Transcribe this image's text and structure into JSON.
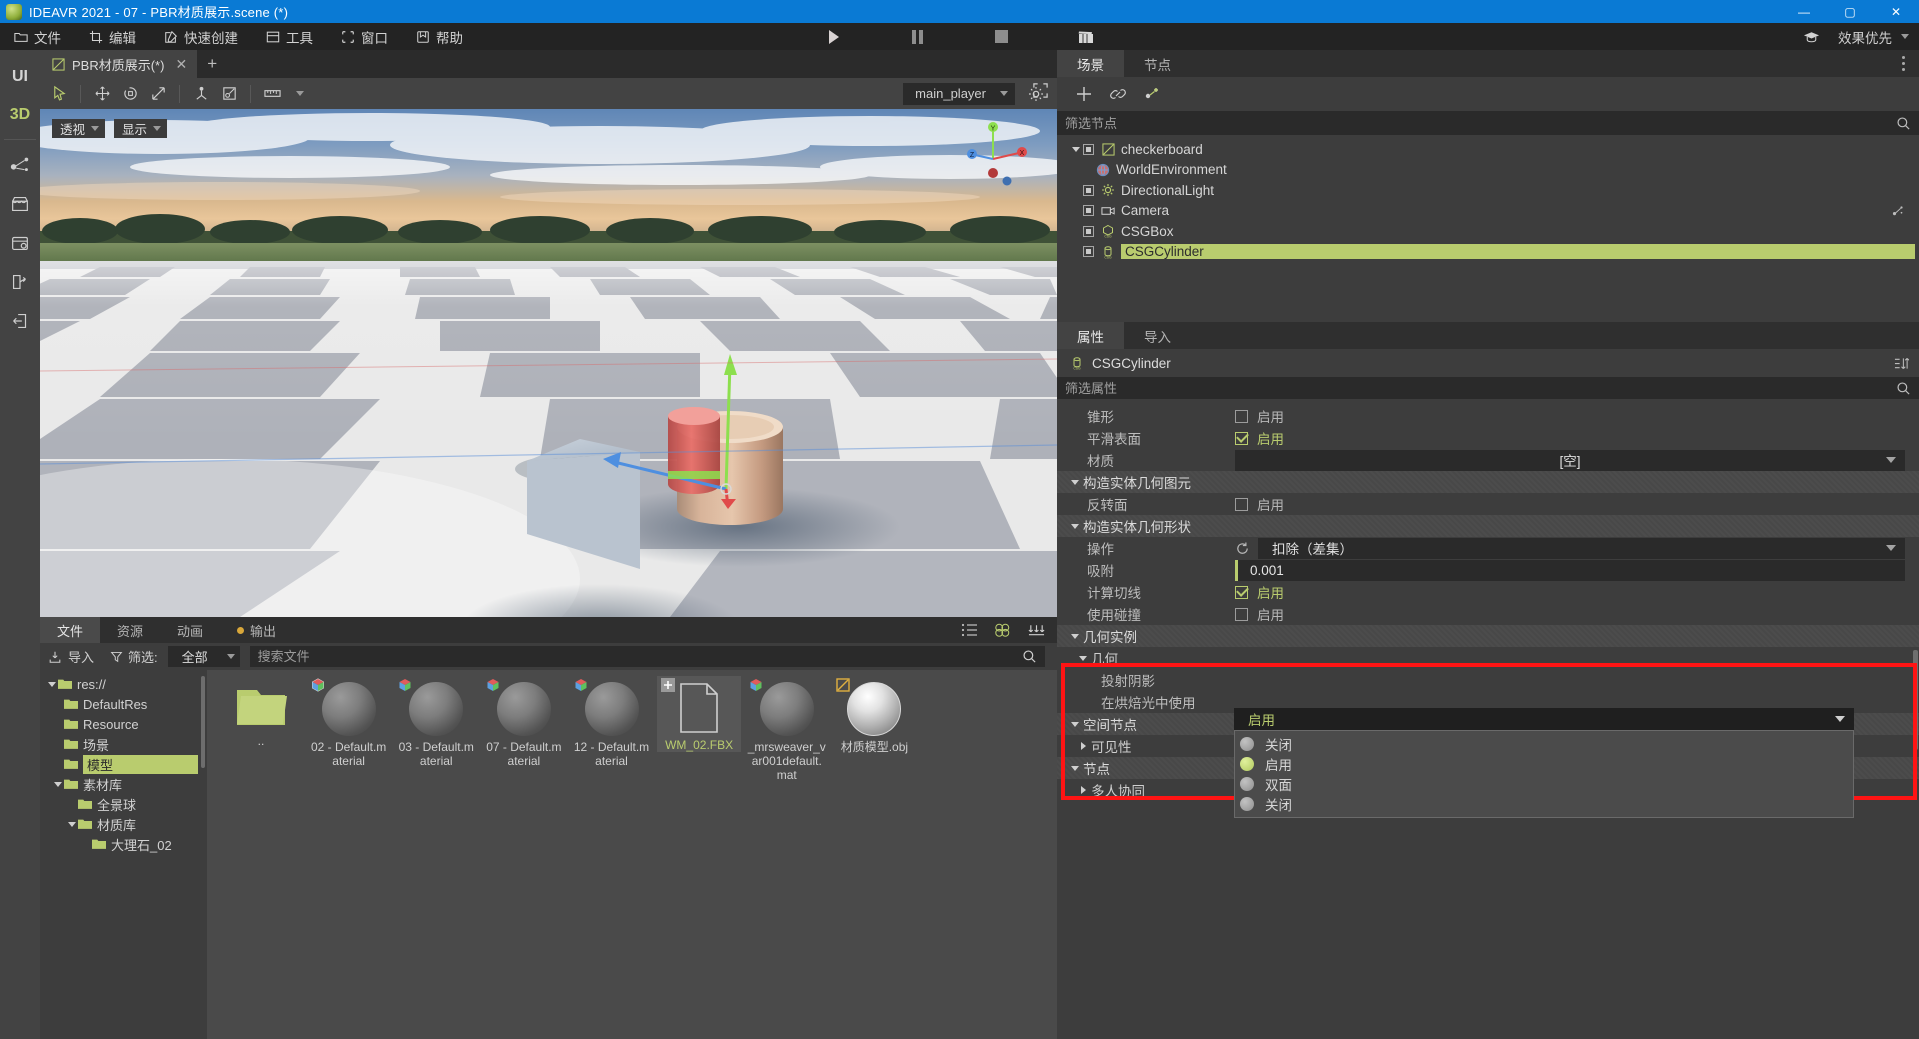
{
  "titlebar": {
    "title": "IDEAVR 2021 - 07 - PBR材质展示.scene (*)",
    "minimize": "—",
    "maximize": "▢",
    "close": "✕"
  },
  "menubar": {
    "items": [
      {
        "label": "文件",
        "icon": "folder-icon"
      },
      {
        "label": "编辑",
        "icon": "edit-crop-icon"
      },
      {
        "label": "快速创建",
        "icon": "pencil-square-icon"
      },
      {
        "label": "工具",
        "icon": "window-icon"
      },
      {
        "label": "窗口",
        "icon": "frame-icon"
      },
      {
        "label": "帮助",
        "icon": "help-book-icon"
      }
    ],
    "playback": [
      {
        "name": "play-button",
        "icon": "play-icon"
      },
      {
        "name": "pause-button",
        "icon": "pause-icon"
      },
      {
        "name": "stop-button",
        "icon": "stop-icon"
      },
      {
        "name": "movie-button",
        "icon": "clapperboard-icon"
      }
    ],
    "right": {
      "graduation_icon": "graduation-cap-icon",
      "quality_label": "效果优先"
    }
  },
  "rail": {
    "ui_label": "UI",
    "d3_label": "3D",
    "buttons": [
      {
        "name": "node-graph-icon"
      },
      {
        "name": "store-icon"
      },
      {
        "name": "settings-window-icon"
      },
      {
        "name": "export-icon"
      },
      {
        "name": "import-door-icon"
      }
    ]
  },
  "editor": {
    "tab": {
      "label": "PBR材质展示(*)",
      "close": "✕",
      "add": "+"
    },
    "toolbar": {
      "tools": [
        {
          "name": "select-tool",
          "icon": "cursor-icon",
          "active": true
        },
        {
          "name": "move-tool",
          "icon": "move-arrows-icon"
        },
        {
          "name": "rotate-tool",
          "icon": "rotate-icon"
        },
        {
          "name": "scale-tool",
          "icon": "scale-icon"
        },
        {
          "name": "snap-tool",
          "icon": "anchor-icon"
        },
        {
          "name": "local-space-tool",
          "icon": "local-space-icon"
        },
        {
          "name": "ruler-tool",
          "icon": "ruler-icon"
        }
      ],
      "player_select": "main_player",
      "settings_icon": "gear-icon"
    },
    "viewport": {
      "perspective_label": "透视",
      "display_label": "显示",
      "expand_icon": "expand-icon",
      "gizmo_axes": [
        "X",
        "Y",
        "Z"
      ]
    }
  },
  "filepanel": {
    "tabs": [
      {
        "label": "文件",
        "active": true
      },
      {
        "label": "资源",
        "active": false
      },
      {
        "label": "动画",
        "active": false
      },
      {
        "label": "输出",
        "active": false,
        "dot": true
      }
    ],
    "tools_right": [
      {
        "name": "list-view-icon"
      },
      {
        "name": "grid-view-icon"
      },
      {
        "name": "sort-icon"
      }
    ],
    "toolbar": {
      "import_label": "导入",
      "import_icon": "import-icon",
      "filter_label": "筛选:",
      "filter_icon": "funnel-icon",
      "filter_value": "全部",
      "search_placeholder": "搜索文件",
      "search_value": "",
      "search_icon": "search-icon"
    },
    "tree": [
      {
        "label": "res://",
        "depth": 0,
        "expanded": true,
        "selected": false
      },
      {
        "label": "DefaultRes",
        "depth": 1,
        "expanded": null,
        "selected": false
      },
      {
        "label": "Resource",
        "depth": 1,
        "expanded": null,
        "selected": false
      },
      {
        "label": "场景",
        "depth": 1,
        "expanded": null,
        "selected": false
      },
      {
        "label": "模型",
        "depth": 1,
        "expanded": null,
        "selected": true
      },
      {
        "label": "素材库",
        "depth": 1,
        "expanded": true,
        "selected": false
      },
      {
        "label": "全景球",
        "depth": 2,
        "expanded": null,
        "selected": false
      },
      {
        "label": "材质库",
        "depth": 2,
        "expanded": true,
        "selected": false
      },
      {
        "label": "大理石_02",
        "depth": 3,
        "expanded": null,
        "selected": false
      }
    ],
    "files": [
      {
        "name": "..",
        "kind": "folder",
        "selected": false,
        "badge": null
      },
      {
        "name": "02 - Default.material",
        "kind": "sphere",
        "selected": false,
        "badge": "material-badge"
      },
      {
        "name": "03 - Default.material",
        "kind": "sphere",
        "selected": false,
        "badge": "material-badge"
      },
      {
        "name": "07 - Default.material",
        "kind": "sphere",
        "selected": false,
        "badge": "material-badge"
      },
      {
        "name": "12 - Default.material",
        "kind": "sphere",
        "selected": false,
        "badge": "material-badge"
      },
      {
        "name": "WM_02.FBX",
        "kind": "document",
        "selected": true,
        "badge": "fbx-badge"
      },
      {
        "name": "_mrsweaver_var001default.mat",
        "kind": "sphere",
        "selected": false,
        "badge": "material-badge"
      },
      {
        "name": "材质模型.obj",
        "kind": "shiny-sphere",
        "selected": false,
        "badge": "obj-badge"
      }
    ]
  },
  "dock": {
    "tabs": [
      {
        "label": "场景",
        "active": true
      },
      {
        "label": "节点",
        "active": false
      }
    ],
    "toolbar": [
      {
        "name": "add-node-button",
        "icon": "plus-icon"
      },
      {
        "name": "link-scene-button",
        "icon": "link-icon"
      },
      {
        "name": "instance-node-button",
        "icon": "instance-icon"
      }
    ],
    "filter_placeholder": "筛选节点",
    "filter_value": "",
    "search_icon": "search-icon",
    "nodes": [
      {
        "label": "checkerboard",
        "depth": 0,
        "expanded": true,
        "icon": "scene-icon",
        "vis": true,
        "selected": false,
        "script": false
      },
      {
        "label": "WorldEnvironment",
        "depth": 1,
        "expanded": null,
        "icon": "world-icon",
        "vis": false,
        "selected": false,
        "script": false
      },
      {
        "label": "DirectionalLight",
        "depth": 1,
        "expanded": null,
        "icon": "sun-icon",
        "vis": true,
        "selected": false,
        "script": false
      },
      {
        "label": "Camera",
        "depth": 1,
        "expanded": null,
        "icon": "camera-icon",
        "vis": true,
        "selected": false,
        "script": true
      },
      {
        "label": "CSGBox",
        "depth": 1,
        "expanded": null,
        "icon": "csg-icon",
        "vis": true,
        "selected": false,
        "script": false
      },
      {
        "label": "CSGCylinder",
        "depth": 1,
        "expanded": null,
        "icon": "csg-icon",
        "vis": true,
        "selected": true,
        "script": false
      }
    ]
  },
  "inspector": {
    "tabs": [
      {
        "label": "属性",
        "active": true
      },
      {
        "label": "导入",
        "active": false
      }
    ],
    "object_name": "CSGCylinder",
    "object_icon": "csg-icon",
    "header_tools": [
      {
        "name": "sort-properties-icon"
      },
      {
        "name": "expand-icon"
      }
    ],
    "filter_placeholder": "筛选属性",
    "filter_value": "",
    "rows": [
      {
        "type": "prop",
        "label": "锥形",
        "control": "checkbox",
        "checked": false,
        "text": "启用"
      },
      {
        "type": "prop",
        "label": "平滑表面",
        "control": "checkbox",
        "checked": true,
        "text": "启用"
      },
      {
        "type": "prop",
        "label": "材质",
        "control": "combo",
        "value": "[空]"
      },
      {
        "type": "section",
        "label": "构造实体几何图元",
        "expanded": true
      },
      {
        "type": "prop",
        "label": "反转面",
        "control": "checkbox",
        "checked": false,
        "text": "启用"
      },
      {
        "type": "section",
        "label": "构造实体几何形状",
        "expanded": true
      },
      {
        "type": "prop",
        "label": "操作",
        "control": "combo-left",
        "value": "扣除（差集）",
        "revert": true
      },
      {
        "type": "prop",
        "label": "吸附",
        "control": "number",
        "value": "0.001"
      },
      {
        "type": "prop",
        "label": "计算切线",
        "control": "checkbox",
        "checked": true,
        "text": "启用"
      },
      {
        "type": "prop",
        "label": "使用碰撞",
        "control": "checkbox",
        "checked": false,
        "text": "启用"
      },
      {
        "type": "section",
        "label": "几何实例",
        "expanded": true
      },
      {
        "type": "subsection",
        "label": "几何",
        "expanded": true
      },
      {
        "type": "prop",
        "label": "投射阴影",
        "control": "dropdown-open",
        "value": "启用",
        "indent": 2
      },
      {
        "type": "prop",
        "label": "在烘焙光中使用",
        "control": "none",
        "indent": 2
      },
      {
        "type": "section",
        "label": "空间节点",
        "expanded": true
      },
      {
        "type": "subsection",
        "label": "可见性",
        "expanded": false
      },
      {
        "type": "section",
        "label": "节点",
        "expanded": true
      },
      {
        "type": "subsection",
        "label": "多人协同",
        "expanded": false
      }
    ],
    "shadow_dropdown": {
      "selected": "启用",
      "options": [
        {
          "label": "关闭",
          "selected": false
        },
        {
          "label": "启用",
          "selected": true
        },
        {
          "label": "双面",
          "selected": false
        },
        {
          "label": "关闭",
          "selected": false
        }
      ]
    },
    "annotation_color": "#ff1414"
  }
}
